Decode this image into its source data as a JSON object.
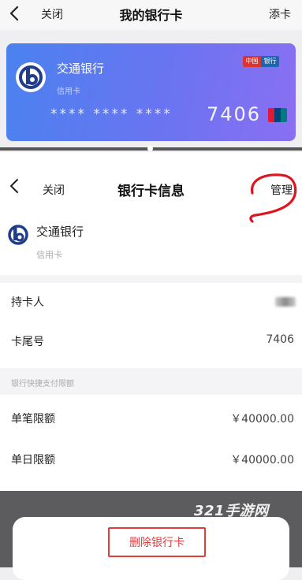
{
  "top_bar": {
    "close_label": "关闭",
    "title": "我的银行卡",
    "add_label": "添卡"
  },
  "card": {
    "bank_name": "交通银行",
    "card_type": "信用卡",
    "masked_number": "**** **** ****",
    "tail_digits": "7406",
    "gradient_colors": [
      "#4b82f0",
      "#8a6ff2"
    ],
    "brand_badge": [
      "中国",
      "银行"
    ],
    "network_logo": "unionpay-logo"
  },
  "panel": {
    "close_label": "关闭",
    "title": "银行卡信息",
    "manage_label": "管理",
    "bank_name": "交通银行",
    "card_type": "信用卡",
    "rows": [
      {
        "label": "持卡人",
        "value": ""
      },
      {
        "label": "卡尾号",
        "value": "7406"
      }
    ],
    "limits_section_title": "银行快捷支付限额",
    "limit_rows": [
      {
        "label": "单笔限额",
        "value": "￥40000.00"
      },
      {
        "label": "单日限额",
        "value": "￥40000.00"
      }
    ]
  },
  "bottom": {
    "delete_label": "删除银行卡",
    "accent_color": "#e13b3b"
  },
  "watermark": "321手游网"
}
